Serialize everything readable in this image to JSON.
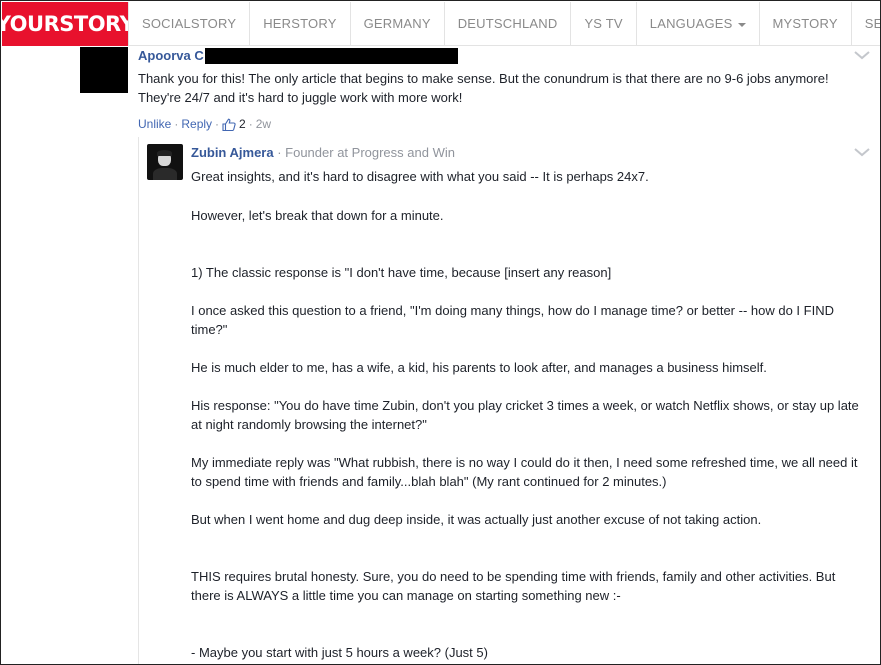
{
  "header": {
    "logo": "YOURSTORY",
    "nav": [
      "SOCIALSTORY",
      "HERSTORY",
      "GERMANY",
      "DEUTSCHLAND",
      "YS TV",
      "LANGUAGES",
      "MYSTORY",
      "SECTION"
    ]
  },
  "comment": {
    "author_visible": "Apoorva C",
    "body": "Thank you for this! The only article that begins to make sense. But the conundrum is that there are no 9-6 jobs anymore! They're 24/7 and it's hard to juggle work with more work!",
    "actions": {
      "unlike": "Unlike",
      "reply": "Reply",
      "likes": "2",
      "time": "2w"
    }
  },
  "reply": {
    "author": "Zubin Ajmera",
    "title": "· Founder at Progress and Win",
    "paragraphs": [
      "Great insights, and it's hard to disagree with what you said -- It is perhaps 24x7.",
      "However, let's break that down for a minute.",
      "1) The classic response is \"I don't have time, because [insert any reason]",
      "I once asked this question to a friend, \"I'm doing many things, how do I manage time? or better -- how do I FIND time?\"",
      "He is much elder to me, has a wife, a kid, his parents to look after, and manages a business himself.",
      "His response: \"You do have time Zubin, don't you play cricket 3 times a week, or watch Netflix shows, or stay up late at night randomly browsing the internet?\"",
      "My immediate reply was \"What rubbish, there is no way I could do it then, I need some refreshed time, we all need it to spend time with friends and family...blah blah\" (My rant continued for 2 minutes.)",
      "But when I went home and dug deep inside, it was actually just another excuse of not taking action.",
      "THIS requires brutal honesty. Sure, you do need to be spending time with friends, family and other activities. But there is ALWAYS a little time you can manage on starting something new :-",
      "- Maybe you start with just 5 hours a week? (Just 5)"
    ]
  },
  "colors": {
    "brand": "#e8112d",
    "link": "#365899",
    "meta": "#90949c",
    "text": "#1d2129"
  }
}
